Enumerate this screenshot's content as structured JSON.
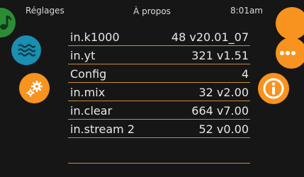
{
  "header": {
    "left_label": "Réglages",
    "title": "À propos",
    "time": "8:01am"
  },
  "side_buttons": {
    "music_icon": "music-note-icon",
    "water_icon": "water-waves-icon",
    "settings_icon": "gears-icon",
    "more_icon": "more-dots-icon",
    "info_icon": "info-icon"
  },
  "colors": {
    "accent_orange": "#f7931e",
    "blue": "#1a8fb0",
    "green": "#2c8c36",
    "rule": "#c98a3c"
  },
  "rows": [
    {
      "key": "in.k1000",
      "value": "48 v20.01_07"
    },
    {
      "key": "in.yt",
      "value": "321 v1.51"
    },
    {
      "key": "Config",
      "value": "4"
    },
    {
      "key": "in.mix",
      "value": "32 v2.00"
    },
    {
      "key": "in.clear",
      "value": "664 v7.00"
    },
    {
      "key": "in.stream 2",
      "value": "52 v0.00"
    }
  ]
}
